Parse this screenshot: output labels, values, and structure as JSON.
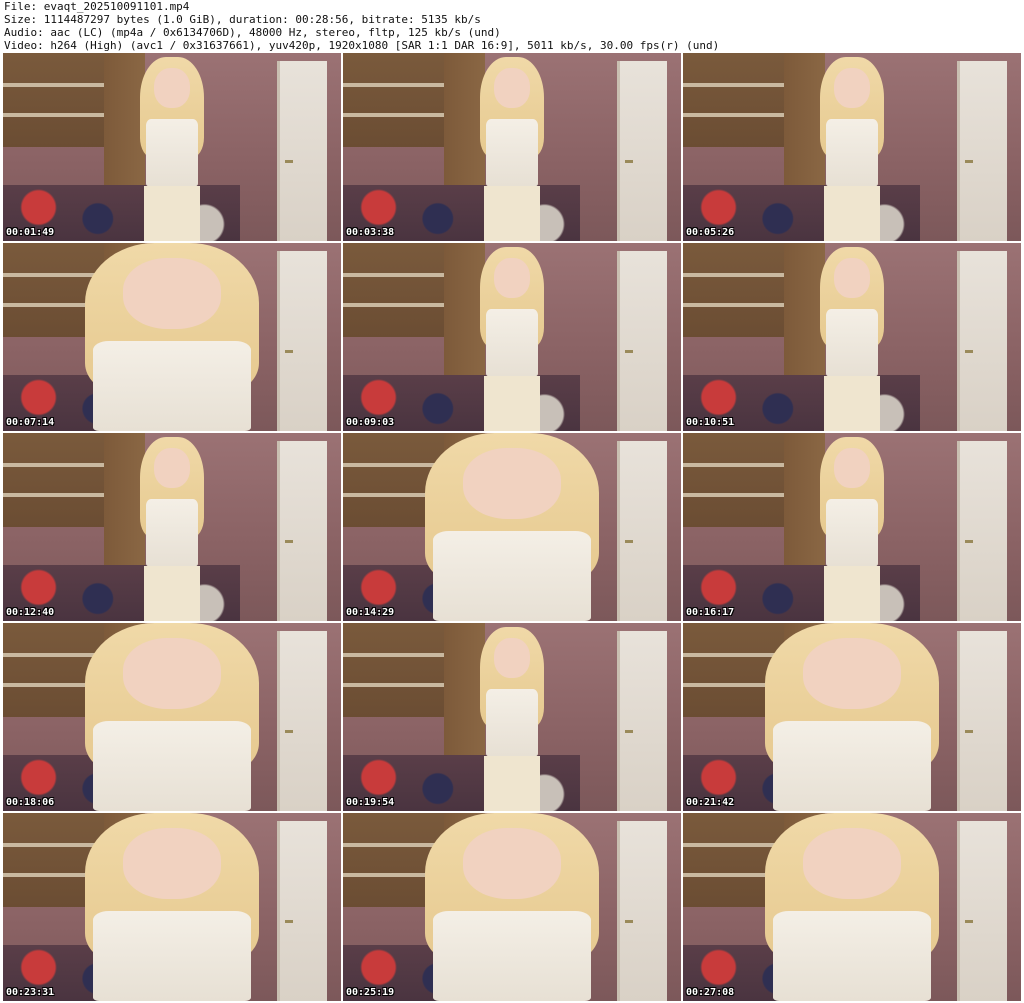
{
  "header": {
    "file_line": "File: evaqt_202510091101.mp4",
    "size_line": "Size: 1114487297 bytes (1.0 GiB), duration: 00:28:56, bitrate: 5135 kb/s",
    "audio_line": "Audio: aac (LC) (mp4a / 0x6134706D), 48000 Hz, stereo, fltp, 125 kb/s (und)",
    "video_line": "Video: h264 (High) (avc1 / 0x31637661), yuv420p, 1920x1080 [SAR 1:1 DAR 16:9], 5011 kb/s, 30.00 fps(r) (und)"
  },
  "thumbnails": [
    {
      "time": "00:01:49",
      "view": "full"
    },
    {
      "time": "00:03:38",
      "view": "full"
    },
    {
      "time": "00:05:26",
      "view": "full"
    },
    {
      "time": "00:07:14",
      "view": "close"
    },
    {
      "time": "00:09:03",
      "view": "full"
    },
    {
      "time": "00:10:51",
      "view": "full"
    },
    {
      "time": "00:12:40",
      "view": "full"
    },
    {
      "time": "00:14:29",
      "view": "close"
    },
    {
      "time": "00:16:17",
      "view": "full"
    },
    {
      "time": "00:18:06",
      "view": "close"
    },
    {
      "time": "00:19:54",
      "view": "full"
    },
    {
      "time": "00:21:42",
      "view": "close"
    },
    {
      "time": "00:23:31",
      "view": "close"
    },
    {
      "time": "00:25:19",
      "view": "close"
    },
    {
      "time": "00:27:08",
      "view": "close"
    }
  ]
}
